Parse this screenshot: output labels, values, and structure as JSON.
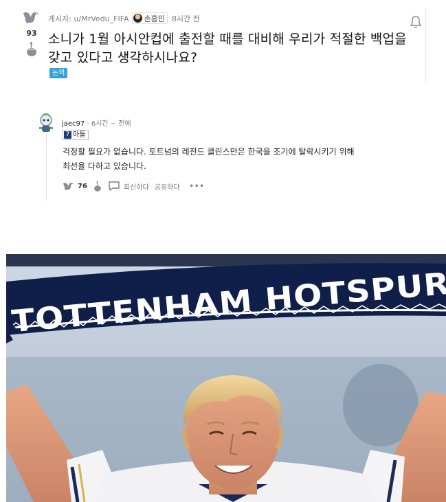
{
  "post": {
    "score": "93",
    "meta": {
      "author_prefix": "게시자: u/MrVedu_FIFA",
      "user_flair": "손흥민",
      "time": "8시간 전"
    },
    "title_line1": "소니가 1월 아시안컵에 출전할 때를 대비해 우리가 적절한 백업을",
    "title_line2": "갖고 있다고 생각하시나요?",
    "tag": "논의"
  },
  "comment": {
    "author": "jaec97",
    "time": "· 6시간 ~ 전에",
    "flair_number": "7",
    "flair_text": "아들",
    "body_line1": "걱정할 필요가 없습니다. 토트넘의 레전드 클린스만은 한국을 조기에 탈락시키기 위해",
    "body_line2": "최선을 다하고 있습니다.",
    "score": "76",
    "reply_label": "회신하다",
    "share_label": "공유하다",
    "more_label": "•••"
  },
  "photo": {
    "scarf_text": "TOTTENHAM HOTSPUR"
  },
  "colors": {
    "tag_bg": "#34a0d6",
    "scarf_navy": "#0f1f4a",
    "flair_navy": "#1f3a78"
  }
}
